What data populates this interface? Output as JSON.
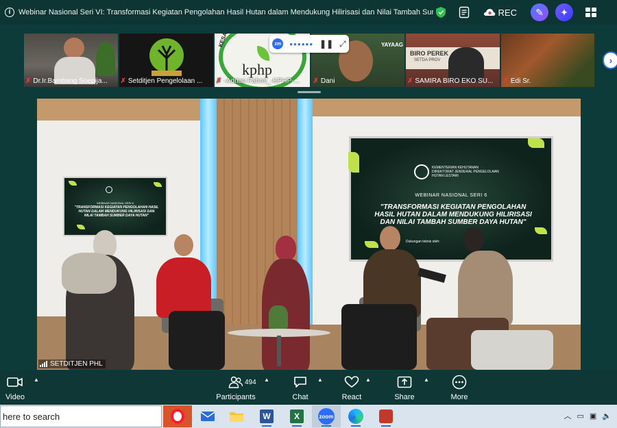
{
  "window": {
    "title": "Webinar Nasional Seri VI: Transformasi Kegiatan Pengolahan Hasil Hutan dalam Mendukung Hilirisasi dan Nilai Tambah Sumber D",
    "rec_label": "REC"
  },
  "participants_strip": [
    {
      "name": "Dr.Ir.Bambang Soepija..."
    },
    {
      "name": "Setditjen Pengelolaan ..."
    },
    {
      "name": "-Adrian Fahmi_-KPHP-..."
    },
    {
      "name": "Dani"
    },
    {
      "name": "SAMIRA BIRO EKO SU..."
    },
    {
      "name": "Edi Sr."
    }
  ],
  "thumb_texts": {
    "kphp_logo_text": "kphp",
    "kesatuan": "KESATUAN",
    "yayasan": "YAYAAG",
    "biro": "BIRO PEREK",
    "setda": "SETDA PROV"
  },
  "floating_control": {
    "logo_text": "zm",
    "dots": "●●●●●●"
  },
  "stage": {
    "label": "SETDITJEN PHL",
    "screen": {
      "org": "KEMENTERIAN KEHUTANAN DIREKTORAT JENDERAL PENGELOLAAN HUTAN LESTARI",
      "series": "WEBINAR NASIONAL SERI 6",
      "headline": "\"TRANSFORMASI KEGIATAN PENGOLAHAN HASIL HUTAN DALAM MENDUKUNG HILIRISASI DAN NILAI TAMBAH SUMBER DAYA HUTAN\"",
      "support": "Dukungan teknis oleh:"
    },
    "small_screen": {
      "series": "WEBINAR NASIONAL SERI 6",
      "headline": "\"TRANSFORMASI KEGIATAN PENGOLAHAN HASIL HUTAN DALAM MENDUKUNG HILIRISASI DAN NILAI TAMBAH SUMBER DAYA HUTAN\""
    }
  },
  "toolbar": {
    "video": "Video",
    "participants": "Participants",
    "participant_count": "494",
    "chat": "Chat",
    "react": "React",
    "share": "Share",
    "more": "More"
  },
  "taskbar": {
    "search_text": "here to search",
    "apps": [
      "opera-icon",
      "mail-icon",
      "file-explorer-icon",
      "word-icon",
      "excel-icon",
      "zoom-icon",
      "edge-icon",
      "app-icon"
    ]
  },
  "colors": {
    "background": "#0d3b3a",
    "accent_blue": "#2d6df6",
    "mic_muted": "#e23b3b"
  }
}
